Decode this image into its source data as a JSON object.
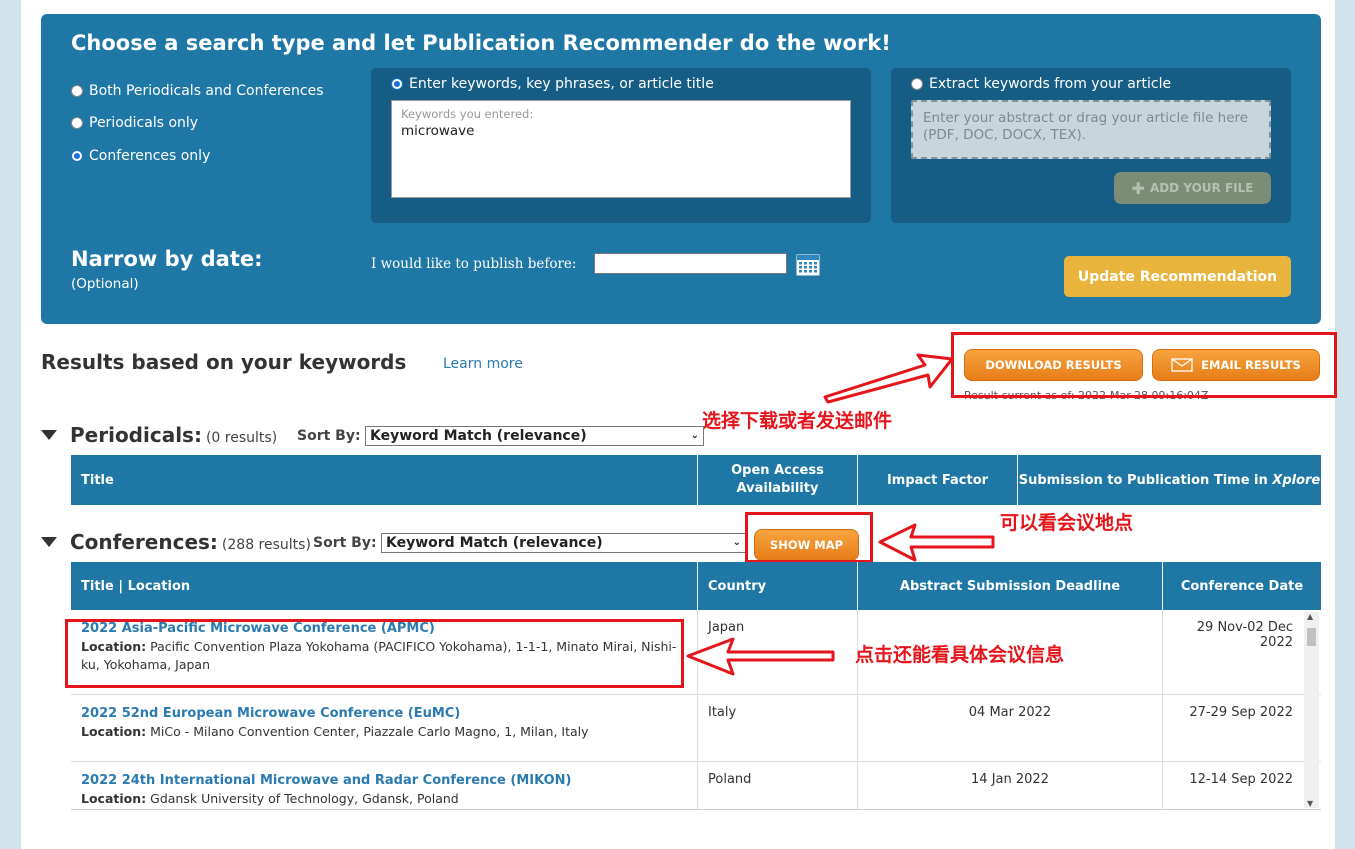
{
  "panel": {
    "title": "Choose a search type and let Publication Recommender do the work!",
    "search_types": [
      {
        "label": "Both Periodicals and Conferences",
        "checked": false
      },
      {
        "label": "Periodicals only",
        "checked": false
      },
      {
        "label": "Conferences only",
        "checked": true
      }
    ],
    "keywords": {
      "label": "Enter keywords, key phrases, or article title",
      "placeholder": "Keywords you entered:",
      "value": "microwave"
    },
    "extract": {
      "label": "Extract keywords from your article",
      "dropzone": "Enter your abstract or drag your article file here (PDF, DOC, DOCX, TEX).",
      "add_file": "ADD YOUR FILE"
    },
    "narrow": {
      "title": "Narrow by date:",
      "subtitle": "(Optional)",
      "publish_label": "I would like to publish before:",
      "date_value": ""
    },
    "update_button": "Update Recommendation"
  },
  "results": {
    "title": "Results based on your keywords",
    "learn_more": "Learn more",
    "download": "DOWNLOAD RESULTS",
    "email": "EMAIL RESULTS",
    "current": "Result current as of: 2022-Mar-28 09:16:04Z"
  },
  "annotations": {
    "download_note": "选择下载或者发送邮件",
    "map_note": "可以看会议地点",
    "detail_note": "点击还能看具体会议信息"
  },
  "periodicals": {
    "name": "Periodicals:",
    "count": "(0 results)",
    "sort_label": "Sort By:",
    "sort_value": "Keyword Match (relevance)",
    "columns": [
      "Title",
      "Open Access Availability",
      "Impact Factor",
      "Submission to Publication Time in",
      "Xplore"
    ]
  },
  "conferences": {
    "name": "Conferences:",
    "count": "(288 results)",
    "sort_label": "Sort By:",
    "sort_value": "Keyword Match (relevance)",
    "show_map": "SHOW MAP",
    "columns": [
      "Title | Location",
      "Country",
      "Abstract Submission Deadline",
      "Conference Date"
    ],
    "location_label": "Location:",
    "rows": [
      {
        "title": "2022 Asia-Pacific Microwave Conference (APMC)",
        "location": "Pacific Convention Plaza Yokohama (PACIFICO Yokohama), 1-1-1, Minato Mirai, Nishi-ku, Yokohama, Japan",
        "country": "Japan",
        "deadline": "",
        "date": "29 Nov-02 Dec 2022"
      },
      {
        "title": "2022 52nd European Microwave Conference (EuMC)",
        "location": "MiCo - Milano Convention Center, Piazzale Carlo Magno, 1, Milan, Italy",
        "country": "Italy",
        "deadline": "04 Mar 2022",
        "date": "27-29 Sep 2022"
      },
      {
        "title": "2022 24th International Microwave and Radar Conference (MIKON)",
        "location": "Gdansk University of Technology, Gdansk, Poland",
        "country": "Poland",
        "deadline": "14 Jan 2022",
        "date": "12-14 Sep 2022"
      }
    ]
  }
}
